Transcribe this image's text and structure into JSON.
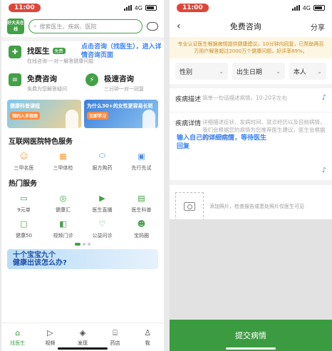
{
  "left": {
    "status": {
      "time": "11:00",
      "network": "4G"
    },
    "header": {
      "logo_text": "好大夫在线",
      "search_placeholder": "搜索医生、疾病、医院"
    },
    "find_doctor": {
      "title": "找医生",
      "tag": "免费",
      "subtitle": "在线咨询·一对一解答健康问题"
    },
    "annotation": "点击咨询（找医生），进入详情咨询页面",
    "free_consult": {
      "title": "免费咨询",
      "subtitle": "免费为您解答疑问"
    },
    "fast_consult": {
      "title": "极速咨询",
      "subtitle": "三分钟一对一回复"
    },
    "banner_a": {
      "text": "健康科普课程",
      "pill": "预约入手指南"
    },
    "banner_b": {
      "text": "为什么30+的女性更容易长斑",
      "pill": "立即学习"
    },
    "hospital_section": {
      "title": "互联网医院特色服务",
      "items": [
        {
          "label": "三甲名医",
          "icon": "doctor-icon"
        },
        {
          "label": "三甲体检",
          "icon": "calendar-icon"
        },
        {
          "label": "报方购药",
          "icon": "pill-icon"
        },
        {
          "label": "先行先试",
          "icon": "screen-icon"
        }
      ]
    },
    "hot_section": {
      "title": "热门服务",
      "items": [
        {
          "label": "9元单",
          "icon": "coupon-icon"
        },
        {
          "label": "健康汇",
          "icon": "target-icon"
        },
        {
          "label": "医生直播",
          "icon": "live-icon"
        },
        {
          "label": "医生科普",
          "icon": "book-icon"
        },
        {
          "label": "健康50",
          "icon": "checkup-icon"
        },
        {
          "label": "视频门诊",
          "icon": "video-icon"
        },
        {
          "label": "公益问诊",
          "icon": "heart-plus-icon"
        },
        {
          "label": "宝妈圈",
          "icon": "group-icon"
        }
      ]
    },
    "promo": {
      "line1": "十个宝宝九个",
      "line2": "健康出该怎么办?"
    },
    "tabs": [
      {
        "label": "找医生",
        "icon": "home-icon"
      },
      {
        "label": "视频",
        "icon": "play-icon"
      },
      {
        "label": "发现",
        "icon": "compass-icon"
      },
      {
        "label": "药店",
        "icon": "store-icon"
      },
      {
        "label": "我",
        "icon": "user-icon"
      }
    ],
    "colors": {
      "accent": "#43a047",
      "annotation": "#3b82f6"
    }
  },
  "right": {
    "status": {
      "time": "11:00",
      "network": "4G"
    },
    "nav": {
      "back": "‹",
      "title": "免费咨询",
      "share": "分享"
    },
    "notice": "专业认证医生根据病情提供健康建议，10分钟内回复，已帮助两百万用户解答超过2000万个健康问题，好评率89%。",
    "selects": [
      {
        "label": "性别"
      },
      {
        "label": "出生日期"
      },
      {
        "label": "本人"
      }
    ],
    "field_title": {
      "label": "疾病描述",
      "placeholder": "简单一句话描述病情，10-20字左右"
    },
    "field_detail": {
      "label": "疾病详情",
      "placeholder": "详细描述症状、发病时间、就诊经历以及目前病情，我们会根据您的病情为您推荐医生建议，医生会根据病情给予回复"
    },
    "annotation": "输入自己的详细病情，等待医生回复",
    "upload": {
      "text": "添加照片，检查报告或患处照片仅医生可见"
    },
    "submit": "提交病情",
    "colors": {
      "accent": "#3b9b40",
      "notice_bg": "#fdf6e3"
    }
  }
}
